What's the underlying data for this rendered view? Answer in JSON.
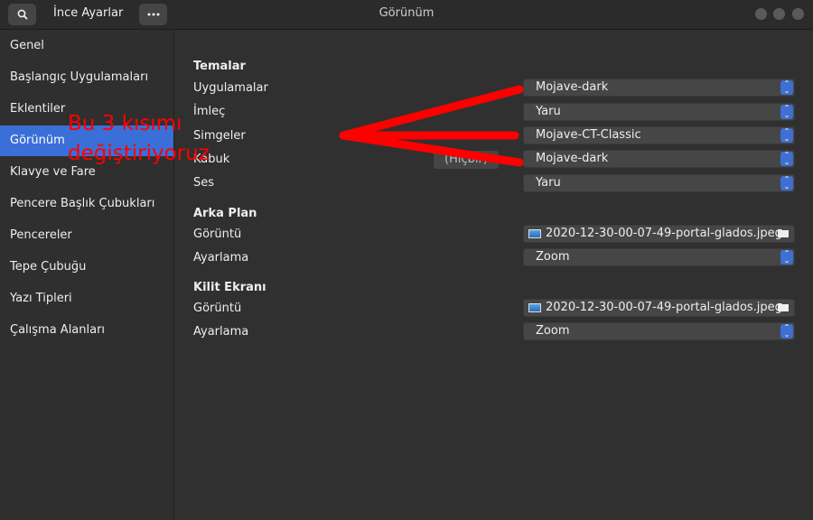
{
  "titlebar": {
    "app_title": "İnce Ayarlar",
    "window_title": "Görünüm"
  },
  "sidebar": {
    "items": [
      {
        "label": "Genel"
      },
      {
        "label": "Başlangıç Uygulamaları"
      },
      {
        "label": "Eklentiler"
      },
      {
        "label": "Görünüm",
        "active": true
      },
      {
        "label": "Klavye ve Fare"
      },
      {
        "label": "Pencere Başlık Çubukları"
      },
      {
        "label": "Pencereler"
      },
      {
        "label": "Tepe Çubuğu"
      },
      {
        "label": "Yazı Tipleri"
      },
      {
        "label": "Çalışma Alanları"
      }
    ]
  },
  "themes": {
    "header": "Temalar",
    "applications": {
      "label": "Uygulamalar",
      "value": "Mojave-dark"
    },
    "cursor": {
      "label": "İmleç",
      "value": "Yaru"
    },
    "icons": {
      "label": "Simgeler",
      "value": "Mojave-CT-Classic"
    },
    "shell": {
      "label": "Kabuk",
      "value": "Mojave-dark",
      "extra_button": "(Hiçbir)"
    },
    "sound": {
      "label": "Ses",
      "value": "Yaru"
    }
  },
  "background": {
    "header": "Arka Plan",
    "image": {
      "label": "Görüntü",
      "value": "2020-12-30-00-07-49-portal-glados.jpeg"
    },
    "adjustment": {
      "label": "Ayarlama",
      "value": "Zoom"
    }
  },
  "lock_screen": {
    "header": "Kilit Ekranı",
    "image": {
      "label": "Görüntü",
      "value": "2020-12-30-00-07-49-portal-glados.jpeg"
    },
    "adjustment": {
      "label": "Ayarlama",
      "value": "Zoom"
    }
  },
  "annotation": {
    "line1": "Bu 3 kısımı",
    "line2": "değiştiriyoruz",
    "color": "#ff0000"
  },
  "colors": {
    "accent": "#3a6fd7",
    "background": "#303030",
    "sidebar": "#2f2f2f"
  }
}
